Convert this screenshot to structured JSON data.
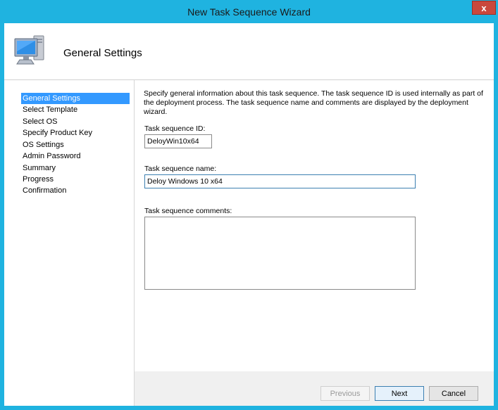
{
  "window": {
    "title": "New Task Sequence Wizard",
    "close_label": "x"
  },
  "header": {
    "title": "General Settings",
    "icon": "computer-icon"
  },
  "sidebar": {
    "items": [
      {
        "label": "General Settings",
        "selected": true
      },
      {
        "label": "Select Template",
        "selected": false
      },
      {
        "label": "Select OS",
        "selected": false
      },
      {
        "label": "Specify Product Key",
        "selected": false
      },
      {
        "label": "OS Settings",
        "selected": false
      },
      {
        "label": "Admin Password",
        "selected": false
      },
      {
        "label": "Summary",
        "selected": false
      },
      {
        "label": "Progress",
        "selected": false
      },
      {
        "label": "Confirmation",
        "selected": false
      }
    ]
  },
  "main": {
    "description": "Specify general information about this task sequence.  The task sequence ID is used internally as part of the deployment process.  The task sequence name and comments are displayed by the deployment wizard.",
    "id_label": "Task sequence ID:",
    "id_value": "DeloyWin10x64",
    "name_label": "Task sequence name:",
    "name_value": "Deloy Windows 10 x64",
    "comments_label": "Task sequence comments:",
    "comments_value": ""
  },
  "footer": {
    "previous_label": "Previous",
    "next_label": "Next",
    "cancel_label": "Cancel"
  },
  "colors": {
    "titlebar": "#1fb3e0",
    "selection": "#3399ff",
    "close": "#c9483c"
  }
}
